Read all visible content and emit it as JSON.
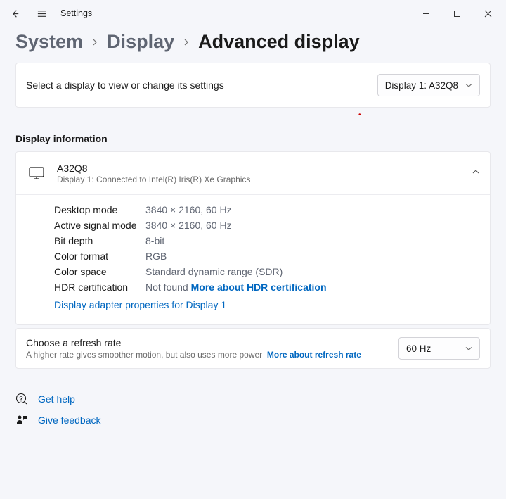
{
  "window": {
    "title": "Settings"
  },
  "breadcrumb": {
    "system": "System",
    "display": "Display",
    "current": "Advanced display"
  },
  "displaySelect": {
    "label": "Select a display to view or change its settings",
    "value": "Display 1: A32Q8"
  },
  "sectionHeading": "Display information",
  "displayInfo": {
    "name": "A32Q8",
    "sub": "Display 1: Connected to Intel(R) Iris(R) Xe Graphics",
    "rows": [
      {
        "key": "Desktop mode",
        "val": "3840 × 2160, 60 Hz"
      },
      {
        "key": "Active signal mode",
        "val": "3840 × 2160, 60 Hz"
      },
      {
        "key": "Bit depth",
        "val": "8-bit"
      },
      {
        "key": "Color format",
        "val": "RGB"
      },
      {
        "key": "Color space",
        "val": "Standard dynamic range (SDR)"
      }
    ],
    "hdrRow": {
      "key": "HDR certification",
      "val": "Not found",
      "link": "More about HDR certification"
    },
    "adapterLink": "Display adapter properties for Display 1"
  },
  "refresh": {
    "title": "Choose a refresh rate",
    "sub": "A higher rate gives smoother motion, but also uses more power",
    "link": "More about refresh rate",
    "value": "60 Hz"
  },
  "footer": {
    "help": "Get help",
    "feedback": "Give feedback"
  }
}
